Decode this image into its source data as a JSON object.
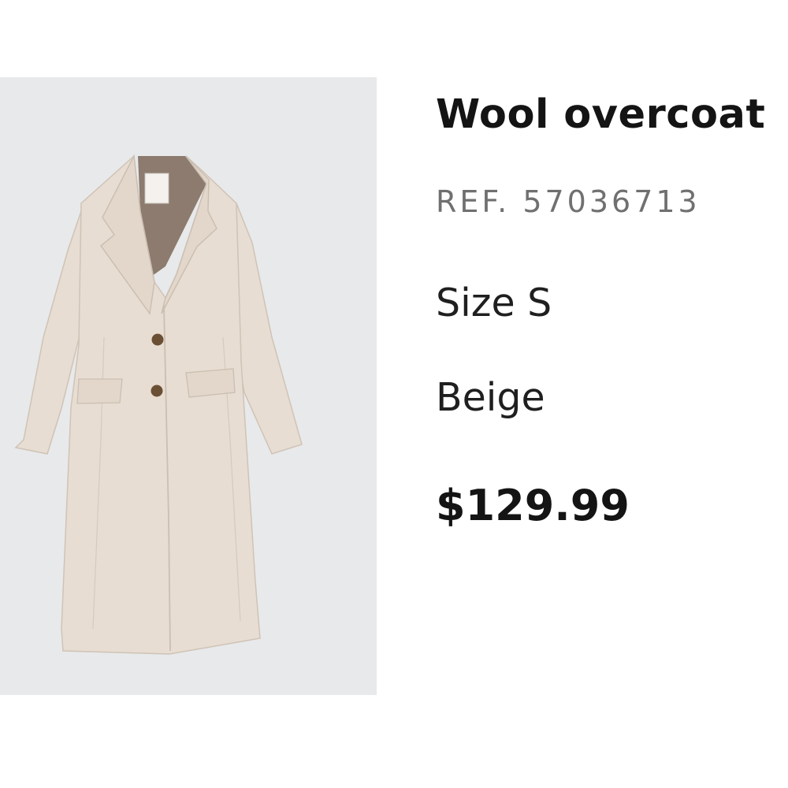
{
  "product": {
    "image_alt": "Wool overcoat",
    "title": "Wool overcoat",
    "reference": "REF.  57036713",
    "size": "Size S",
    "color": "Beige",
    "price": "$129.99"
  },
  "colors": {
    "image_background": "#e8e9eb",
    "coat": "#e8ddd2",
    "lining": "#8c7b6e",
    "buttons": "#6b4f35"
  }
}
